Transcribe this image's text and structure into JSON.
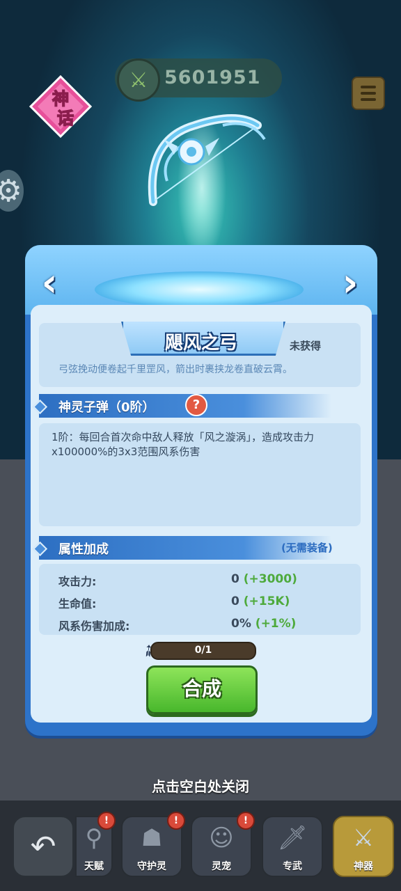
{
  "hud": {
    "power_value": "5601951",
    "mythic_badge": "神话"
  },
  "artifact": {
    "name": "飓风之弓",
    "status": "未获得",
    "description": "弓弦挽动便卷起千里罡风，箭出时裹挟龙卷直破云霄。"
  },
  "skill": {
    "section_title": "神灵子弹（0阶）",
    "help_icon": "?",
    "text": "1阶：每回合首次命中敌人释放「风之漩涡」，造成攻击力x100000%的3x3范围风系伤害"
  },
  "attributes": {
    "section_title": "属性加成",
    "equip_note": "(无需装备)",
    "rows": [
      {
        "label": "攻击力:",
        "base": "0",
        "bonus": "(+3000)"
      },
      {
        "label": "生命值:",
        "base": "0",
        "bonus": "(+15K)"
      },
      {
        "label": "风系伤害加成:",
        "base": "0%",
        "bonus": "(+1%)"
      }
    ]
  },
  "progress": {
    "text": "0/1",
    "fraction": 0
  },
  "compose_label": "合成",
  "close_hint": "点击空白处关闭",
  "nav": [
    {
      "label": "天赋",
      "badge": "!"
    },
    {
      "label": "守护灵",
      "badge": "!"
    },
    {
      "label": "灵宠",
      "badge": "!"
    },
    {
      "label": "专武",
      "badge": ""
    },
    {
      "label": "神器",
      "badge": ""
    }
  ],
  "colors": {
    "accent_blue": "#2d73c9",
    "bonus_green": "#4eaa3c",
    "compose_green": "#48b72c"
  }
}
